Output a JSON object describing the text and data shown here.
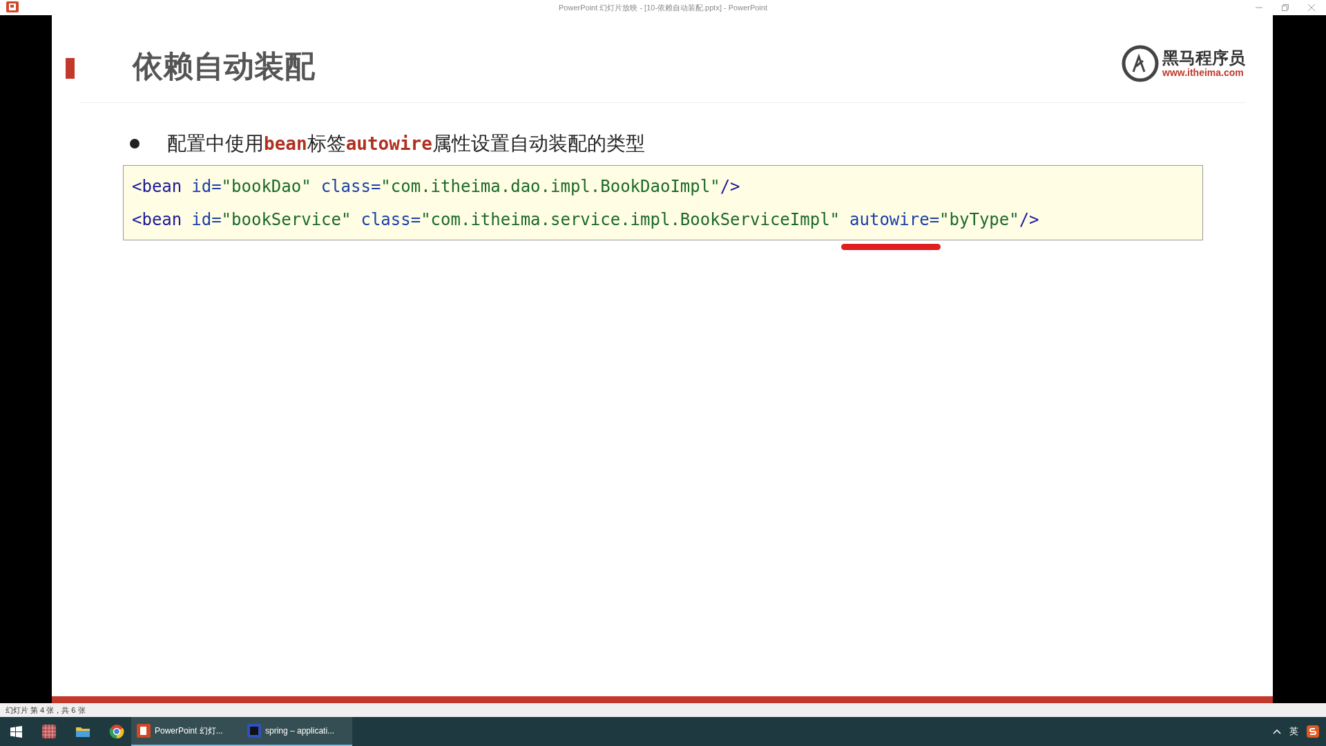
{
  "window": {
    "title": "PowerPoint 幻灯片放映 - [10-依赖自动装配.pptx] - PowerPoint"
  },
  "slide": {
    "title": "依赖自动装配",
    "logo": {
      "name": "黑马程序员",
      "url": "www.itheima.com"
    },
    "bullet": [
      {
        "kind": "text",
        "text": "配置中使用"
      },
      {
        "kind": "code",
        "text": "bean"
      },
      {
        "kind": "text",
        "text": "标签"
      },
      {
        "kind": "code",
        "text": "autowire"
      },
      {
        "kind": "text",
        "text": "属性设置自动装配的类型"
      }
    ],
    "code_lines": [
      [
        {
          "kind": "tag",
          "text": "<bean"
        },
        {
          "kind": "attr",
          "text": "id="
        },
        {
          "kind": "value",
          "text": "\"bookDao\""
        },
        {
          "kind": "attr",
          "text": "class="
        },
        {
          "kind": "value",
          "text": "\"com.itheima.dao.impl.BookDaoImpl\""
        },
        {
          "kind": "tag",
          "text": "/>"
        }
      ],
      [
        {
          "kind": "tag",
          "text": "<bean"
        },
        {
          "kind": "attr",
          "text": "id="
        },
        {
          "kind": "value",
          "text": "\"bookService\""
        },
        {
          "kind": "attr",
          "text": "class="
        },
        {
          "kind": "value",
          "text": "\"com.itheima.service.impl.BookServiceImpl\""
        },
        {
          "kind": "attr",
          "text": "autowire=",
          "underlined": true
        },
        {
          "kind": "value",
          "text": "\"byType\""
        },
        {
          "kind": "tag",
          "text": "/>"
        }
      ]
    ]
  },
  "status_bar": {
    "text": "幻灯片 第 4 张，共 6 张"
  },
  "taskbar": {
    "apps": [
      {
        "label": "PowerPoint 幻灯...",
        "selected": true
      },
      {
        "label": "spring – applicati...",
        "selected": true
      }
    ],
    "language": "英"
  }
}
